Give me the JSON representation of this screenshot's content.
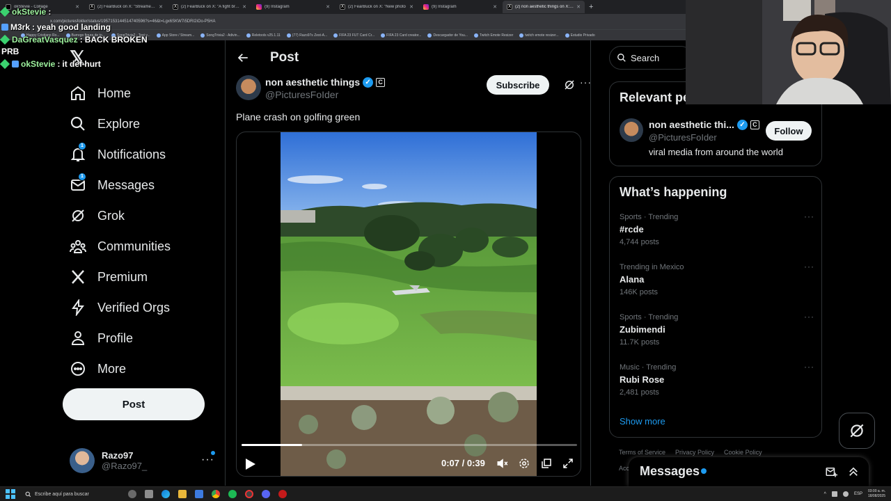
{
  "browser": {
    "tabs": [
      {
        "label": "okStevie - Collage",
        "icon": "twitch-icon"
      },
      {
        "label": "(2) FearBuck on X: \"Streamer w",
        "icon": "x-icon"
      },
      {
        "label": "(2) FearBuck on X: \"A fight brok",
        "icon": "x-icon"
      },
      {
        "label": "(9) Instagram",
        "icon": "instagram-icon"
      },
      {
        "label": "(2) FearBuck on X: \"New photo",
        "icon": "x-icon"
      },
      {
        "label": "(9) Instagram",
        "icon": "instagram-icon"
      },
      {
        "label": "(2) non aesthetic things on X: \"P",
        "icon": "x-icon",
        "active": true
      }
    ],
    "url": "x.com/picturesfolder/status/1957153144514740596?s=46&t=Lgx6SKW7i5DRI2iOo-P5HA",
    "bookmarks": [
      "Happy Cristiano Ro...",
      "Burrego figura de to...",
      "SongTrivia2 - Test y...",
      "App Store / Stream...",
      "SongTrivia2 - Adivin...",
      "Reletools v25.1.11",
      "(77) Razo97s Zest-A...",
      "FIFA 23 FUT Card Cr...",
      "FIFA 23 Card creator...",
      "Descargador de You...",
      "Twitch Emote Resizer",
      "twitch emote resizer...",
      "Estudio Privado"
    ]
  },
  "chat": [
    {
      "user": "okStevie",
      "message": "",
      "user_color": "#9ef29e"
    },
    {
      "user": "M3rk",
      "message": "yeah good landing",
      "user_color": "#ffffff"
    },
    {
      "user": "DaGreatVasquez",
      "message": "BACK BROKEN",
      "extra": "PRB",
      "user_color": "#9ef29e"
    },
    {
      "user": "okStevie",
      "message": "it def hurt",
      "user_color": "#9ef29e"
    }
  ],
  "nav": {
    "items": [
      {
        "label": "Home",
        "icon": "home-icon"
      },
      {
        "label": "Explore",
        "icon": "search-icon"
      },
      {
        "label": "Notifications",
        "icon": "bell-icon",
        "badge": "1"
      },
      {
        "label": "Messages",
        "icon": "mail-icon",
        "badge": "1"
      },
      {
        "label": "Grok",
        "icon": "grok-icon"
      },
      {
        "label": "Communities",
        "icon": "communities-icon"
      },
      {
        "label": "Premium",
        "icon": "x-logo-icon"
      },
      {
        "label": "Verified Orgs",
        "icon": "lightning-icon"
      },
      {
        "label": "Profile",
        "icon": "person-icon"
      },
      {
        "label": "More",
        "icon": "more-circle-icon"
      }
    ],
    "post_button": "Post",
    "account": {
      "name": "Razo97",
      "handle": "@Razo97_",
      "more": "···"
    }
  },
  "main": {
    "title": "Post",
    "author": {
      "name": "non aesthetic things",
      "handle": "@PicturesFoIder",
      "verified": "✓",
      "badge": "C"
    },
    "subscribe": "Subscribe",
    "more": "···",
    "text": "Plane crash on golfing green",
    "video": {
      "time": "0:07 / 0:39",
      "progress": 0.18
    }
  },
  "sidebar": {
    "search_placeholder": "Search",
    "relevant": {
      "title": "Relevant people",
      "name": "non aesthetic thi...",
      "verified": "✓",
      "badge": "C",
      "handle": "@PicturesFoIder",
      "bio": "viral media from around the world",
      "follow": "Follow"
    },
    "happening": {
      "title": "What’s happening",
      "trends": [
        {
          "meta": "Sports · Trending",
          "name": "#rcde",
          "count": "4,744 posts"
        },
        {
          "meta": "Trending in Mexico",
          "name": "Alana",
          "count": "146K posts"
        },
        {
          "meta": "Sports · Trending",
          "name": "Zubimendi",
          "count": "11.7K posts"
        },
        {
          "meta": "Music · Trending",
          "name": "Rubi Rose",
          "count": "2,481 posts"
        }
      ],
      "more_dots": "···",
      "show_more": "Show more"
    },
    "footer": [
      "Terms of Service",
      "Privacy Policy",
      "Cookie Policy"
    ],
    "footer2": "Acc..."
  },
  "messages_drawer": {
    "title": "Messages"
  },
  "taskbar": {
    "search_placeholder": "Escribe aquí para buscar",
    "lang": "ESP",
    "time": "03:00 a. m.",
    "date": "18/08/2025"
  },
  "colors": {
    "accent": "#1d9bf0",
    "background": "#000000",
    "text": "#e7e9ea",
    "muted": "#71767b",
    "border": "#2f3336"
  }
}
